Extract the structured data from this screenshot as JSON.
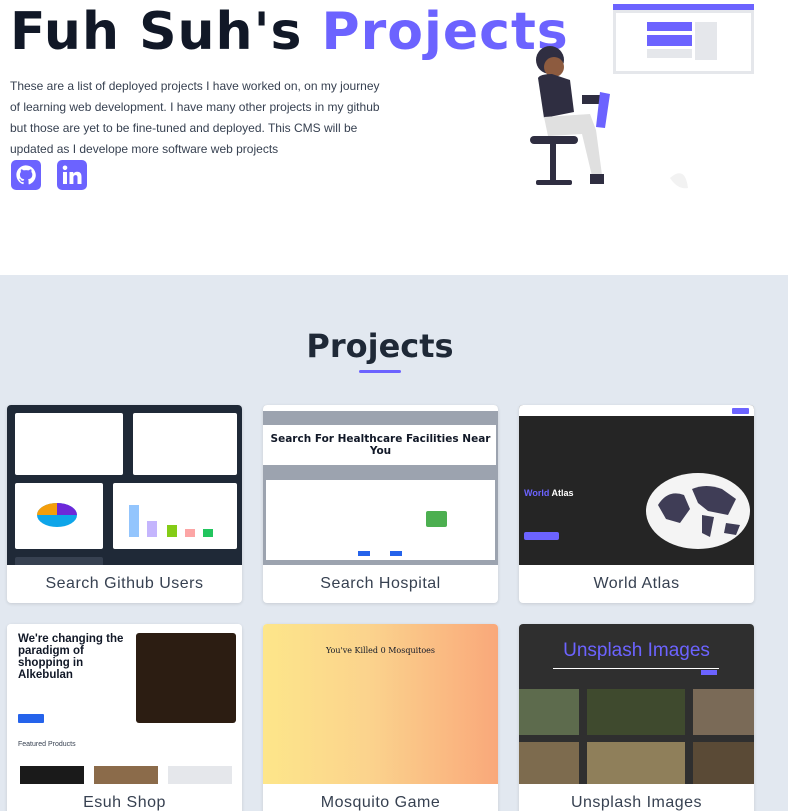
{
  "hero": {
    "title_main": "Fuh Suh's ",
    "title_accent": "Projects",
    "description": "These are a list of deployed projects I have worked on, on my journey of learning web development. I have many other projects in my github but those are yet to be fine-tuned and deployed. This CMS will be updated as I develope more software web projects",
    "socials": [
      {
        "icon": "github-icon"
      },
      {
        "icon": "linkedin-icon"
      }
    ]
  },
  "projects": {
    "heading": "Projects",
    "cards": [
      {
        "title": "Search Github Users"
      },
      {
        "title": "Search Hospital",
        "thumb_text": "Search For Healthcare Facilities Near You"
      },
      {
        "title": "World Atlas",
        "thumb_word": "World",
        "thumb_rest": " Atlas"
      },
      {
        "title": "Esuh Shop",
        "thumb_text": "We're changing the paradigm of shopping in Alkebulan",
        "thumb_sub": "Featured Products"
      },
      {
        "title": "Mosquito Game",
        "thumb_text": "You've Killed 0 Mosquitoes"
      },
      {
        "title": "Unsplash Images",
        "thumb_text": "Unsplash Images"
      }
    ]
  },
  "colors": {
    "accent": "#6c63ff",
    "section_bg": "#e2e8f0"
  }
}
